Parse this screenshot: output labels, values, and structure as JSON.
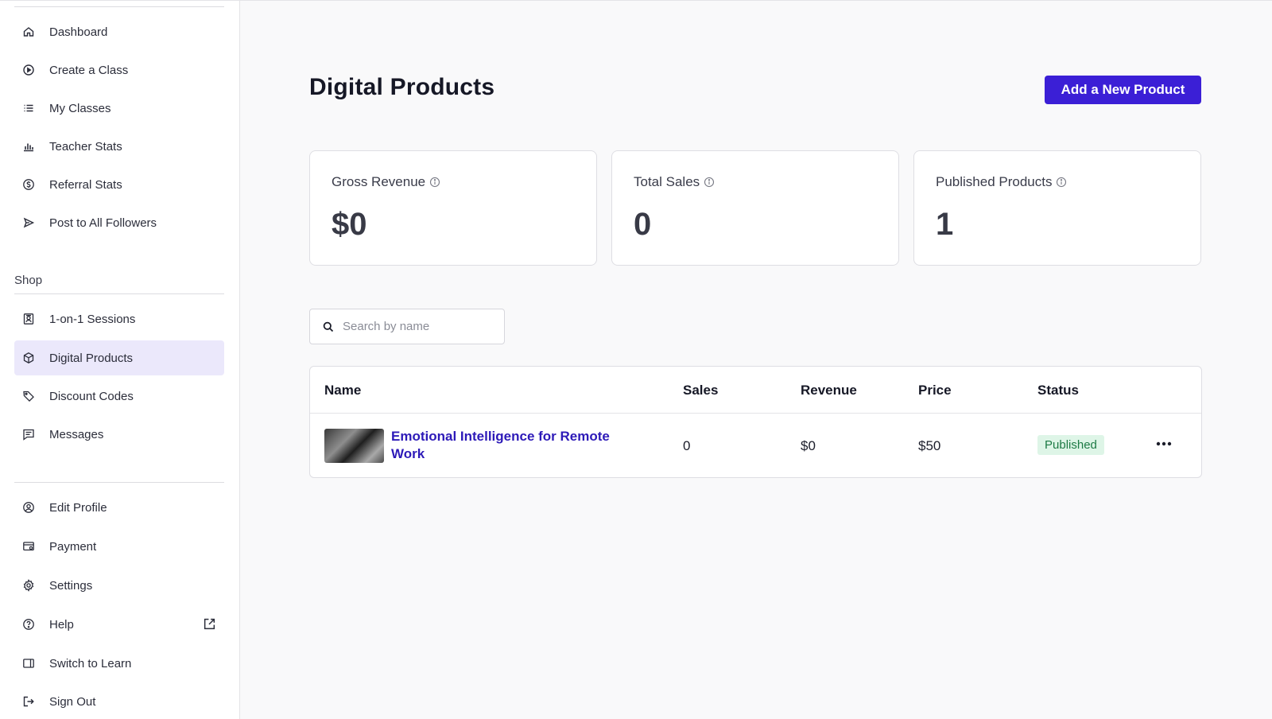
{
  "sidebar": {
    "items_top": [
      {
        "label": "Dashboard",
        "icon": "home-icon"
      },
      {
        "label": "Create a Class",
        "icon": "play-circle-icon"
      },
      {
        "label": "My Classes",
        "icon": "list-icon"
      },
      {
        "label": "Teacher Stats",
        "icon": "bar-chart-icon"
      },
      {
        "label": "Referral Stats",
        "icon": "dollar-circle-icon"
      },
      {
        "label": "Post to All Followers",
        "icon": "send-icon"
      }
    ],
    "shop_section_title": "Shop",
    "items_shop": [
      {
        "label": "1-on-1 Sessions",
        "icon": "person-badge-icon"
      },
      {
        "label": "Digital Products",
        "icon": "cube-icon",
        "active": true
      },
      {
        "label": "Discount Codes",
        "icon": "tag-icon"
      },
      {
        "label": "Messages",
        "icon": "message-icon"
      }
    ],
    "items_bottom": [
      {
        "label": "Edit Profile",
        "icon": "user-circle-icon"
      },
      {
        "label": "Payment",
        "icon": "card-icon"
      },
      {
        "label": "Settings",
        "icon": "gear-icon"
      },
      {
        "label": "Help",
        "icon": "help-circle-icon",
        "external": true
      },
      {
        "label": "Switch to Learn",
        "icon": "switch-icon"
      },
      {
        "label": "Sign Out",
        "icon": "sign-out-icon"
      }
    ]
  },
  "header": {
    "title": "Digital Products",
    "add_button_label": "Add a New Product"
  },
  "stats": [
    {
      "label": "Gross Revenue",
      "value": "$0"
    },
    {
      "label": "Total Sales",
      "value": "0"
    },
    {
      "label": "Published Products",
      "value": "1"
    }
  ],
  "search": {
    "placeholder": "Search by name",
    "value": ""
  },
  "table": {
    "columns": [
      "Name",
      "Sales",
      "Revenue",
      "Price",
      "Status"
    ],
    "rows": [
      {
        "name": "Emotional Intelligence for Remote Work",
        "sales": "0",
        "revenue": "$0",
        "price": "$50",
        "status": "Published"
      }
    ]
  },
  "colors": {
    "accent": "#3b1fd6",
    "link": "#2d1ab8",
    "active_bg": "#ebe8fb",
    "status_bg": "#def5e7",
    "status_text": "#1d7a45"
  }
}
